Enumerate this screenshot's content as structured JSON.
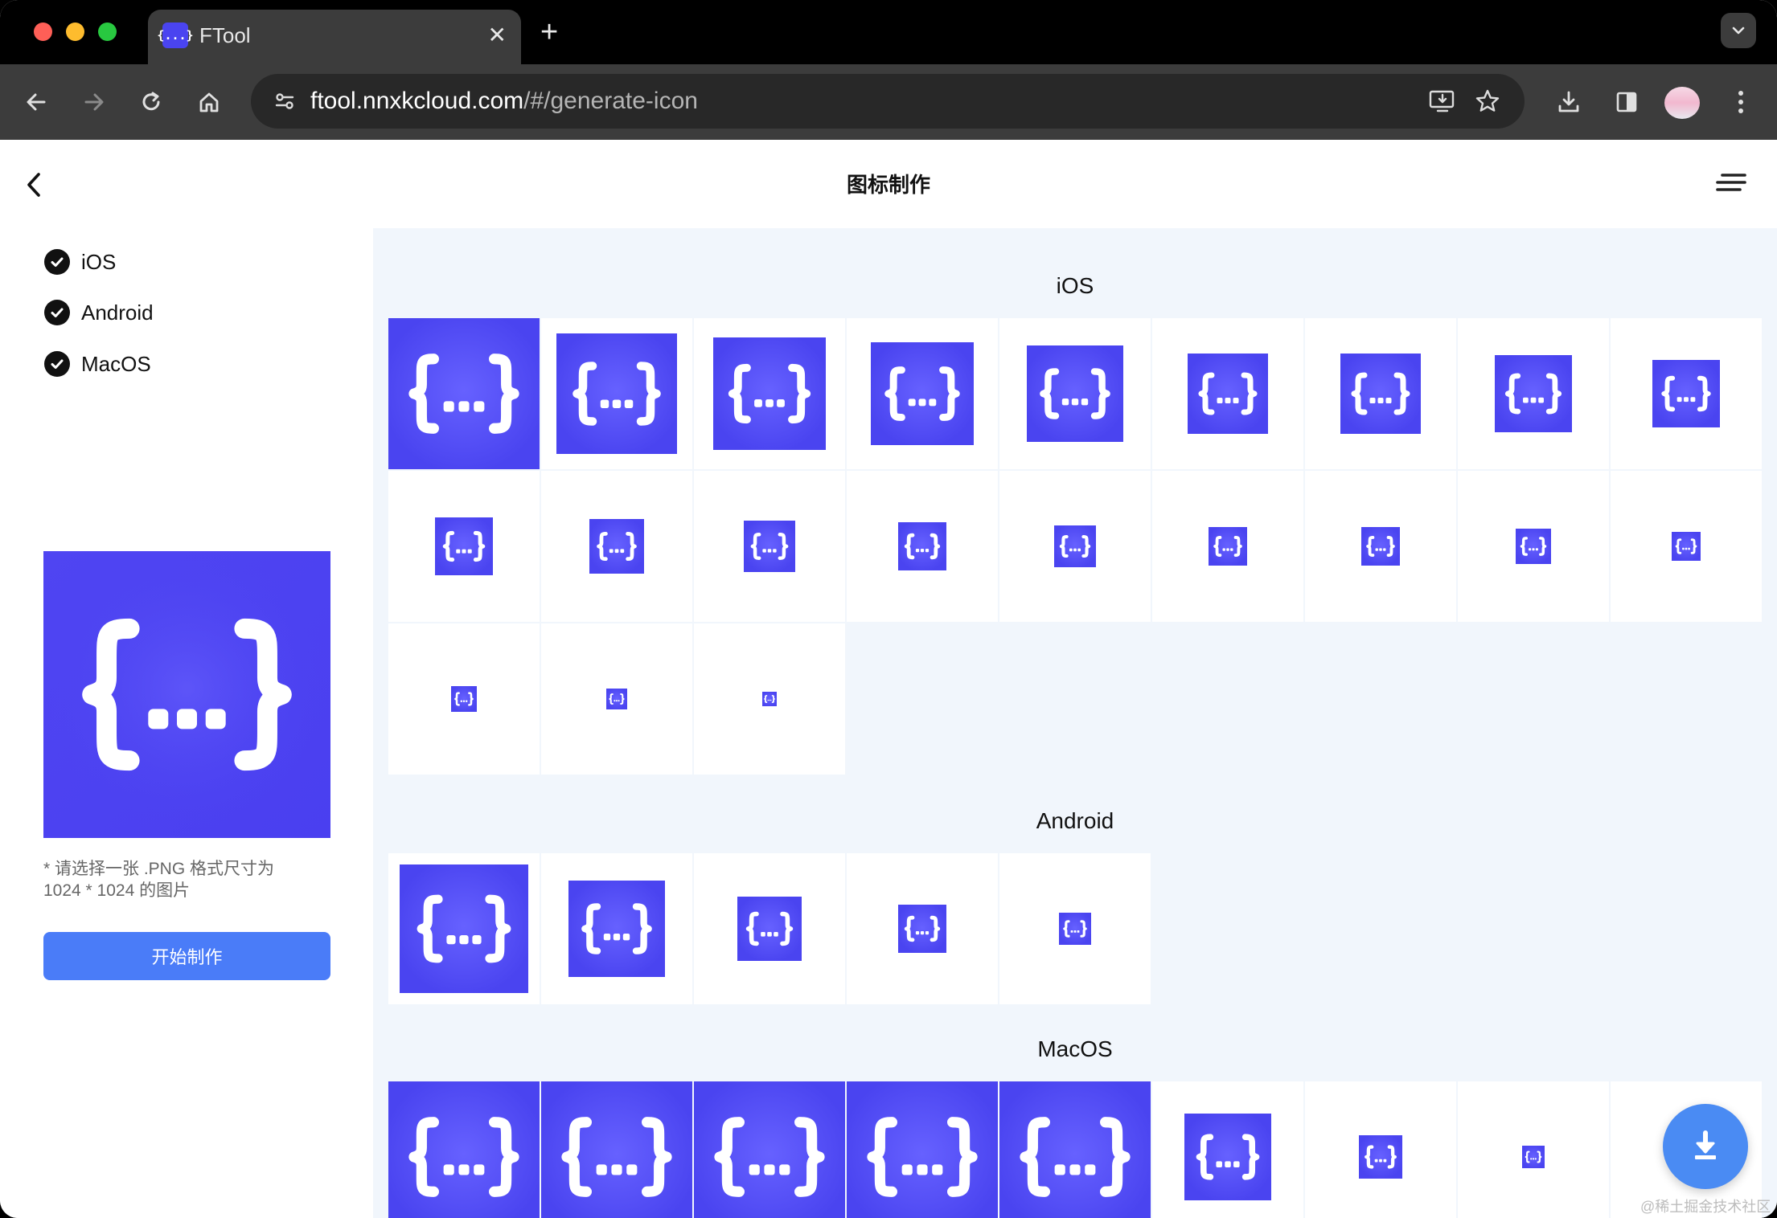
{
  "browser": {
    "tab_title": "FTool",
    "tab_favicon_text": "{...}",
    "url_host": "ftool.nnxkcloud.com",
    "url_path": "/#/generate-icon"
  },
  "page": {
    "title": "图标制作"
  },
  "sidebar": {
    "options": [
      {
        "label": "iOS",
        "checked": true
      },
      {
        "label": "Android",
        "checked": true
      },
      {
        "label": "MacOS",
        "checked": true
      }
    ],
    "hint_line1": "* 请选择一张 .PNG 格式尺寸为",
    "hint_line2": "1024 * 1024 的图片",
    "start_button": "开始制作"
  },
  "sections": {
    "ios": {
      "title": "iOS",
      "icon_count": 21
    },
    "android": {
      "title": "Android",
      "icon_count": 5
    },
    "macos": {
      "title": "MacOS",
      "icon_count": 9
    }
  },
  "colors": {
    "icon_bg": "#4a44f0",
    "accent": "#4a7cf8",
    "fab": "#4a8bf3"
  },
  "watermark": "@稀土掘金技术社区"
}
